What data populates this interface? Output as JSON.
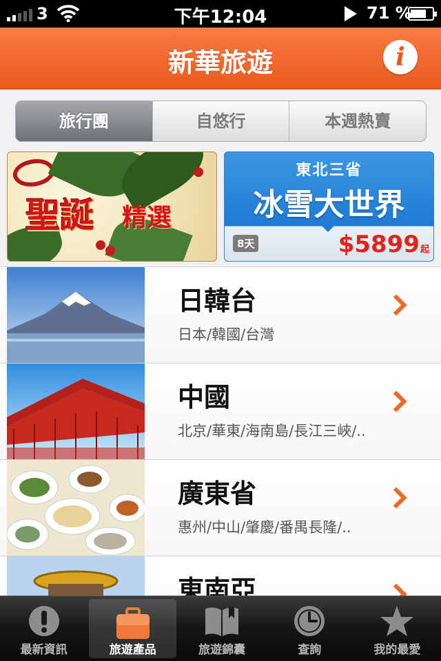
{
  "status_bar": {
    "carrier": "3",
    "time": "下午12:04",
    "battery": "71 %"
  },
  "header": {
    "title": "新華旅遊"
  },
  "segments": [
    {
      "label": "旅行團",
      "active": true
    },
    {
      "label": "自悠行",
      "active": false
    },
    {
      "label": "本週熱賣",
      "active": false
    }
  ],
  "banners": {
    "xmas": {
      "text_main": "聖誕",
      "text_sub": "精選"
    },
    "ice": {
      "subtitle": "東北三省",
      "title": "冰雪大世界",
      "days": "8天",
      "price": "$5899",
      "price_unit": "起"
    }
  },
  "list": [
    {
      "name": "日韓台",
      "desc": "日本/韓國/台灣",
      "image": "mount-fuji"
    },
    {
      "name": "中國",
      "desc": "北京/華東/海南島/長江三峽/..",
      "image": "china-pavilion"
    },
    {
      "name": "廣東省",
      "desc": "惠州/中山/肇慶/番禺長隆/..",
      "image": "seafood-dishes"
    },
    {
      "name": "東南亞",
      "desc": "",
      "image": "golden-dome"
    }
  ],
  "tabbar": [
    {
      "label": "最新資訊",
      "icon": "exclamation-icon",
      "active": false
    },
    {
      "label": "旅遊產品",
      "icon": "suitcase-icon",
      "active": true
    },
    {
      "label": "旅遊錦囊",
      "icon": "book-icon",
      "active": false
    },
    {
      "label": "查詢",
      "icon": "clock-icon",
      "active": false
    },
    {
      "label": "我的最愛",
      "icon": "star-icon",
      "active": false
    }
  ],
  "colors": {
    "accent": "#e95a1d",
    "chevron": "#ee6b25",
    "price": "#e3231b"
  }
}
